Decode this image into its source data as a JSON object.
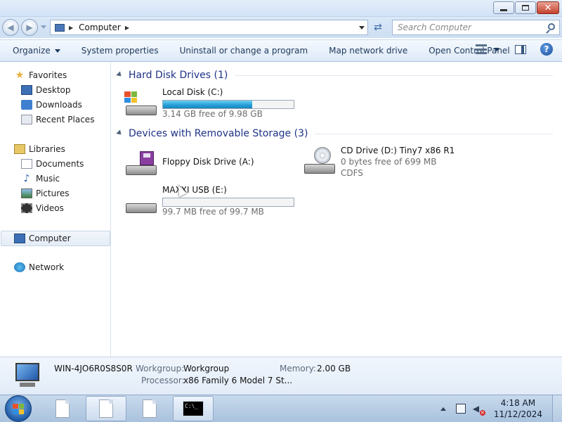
{
  "window": {
    "minimize_icon": "minimize-icon",
    "maximize_icon": "maximize-icon",
    "close_label": "✕"
  },
  "address": {
    "location_icon": "computer-icon",
    "path": "Computer",
    "search_placeholder": "Search Computer"
  },
  "toolbar": {
    "organize": "Organize",
    "system_properties": "System properties",
    "uninstall": "Uninstall or change a program",
    "map_network_drive": "Map network drive",
    "open_control_panel": "Open Control Panel",
    "help_label": "?"
  },
  "sidebar": {
    "favorites": "Favorites",
    "desktop": "Desktop",
    "downloads": "Downloads",
    "recent_places": "Recent Places",
    "libraries": "Libraries",
    "documents": "Documents",
    "music": "Music",
    "pictures": "Pictures",
    "videos": "Videos",
    "computer": "Computer",
    "network": "Network"
  },
  "groups": {
    "hard_disk": "Hard Disk Drives (1)",
    "removable": "Devices with Removable Storage (3)"
  },
  "drives": {
    "c": {
      "name": "Local Disk (C:)",
      "free": "3.14 GB free of 9.98 GB",
      "used_fraction": 0.685
    },
    "a": {
      "name": "Floppy Disk Drive (A:)"
    },
    "d": {
      "name": "CD Drive (D:) Tiny7 x86 R1",
      "free": "0 bytes free of 699 MB",
      "fs": "CDFS"
    },
    "e": {
      "name": "MAXXI USB (E:)",
      "free": "99.7 MB free of 99.7 MB",
      "used_fraction": 0.0
    }
  },
  "details": {
    "computer_name": "WIN-4JO6R0S8S0R",
    "workgroup_label": "Workgroup:",
    "workgroup_value": "Workgroup",
    "memory_label": "Memory:",
    "memory_value": "2.00 GB",
    "processor_label": "Processor:",
    "processor_value": "x86 Family 6 Model 7 St..."
  },
  "taskbar": {
    "cmd_text": "C:\\_",
    "time": "4:18 AM",
    "date": "11/12/2024"
  },
  "colors": {
    "accent": "#1e3287",
    "bar_fill": "#27a0d8"
  }
}
